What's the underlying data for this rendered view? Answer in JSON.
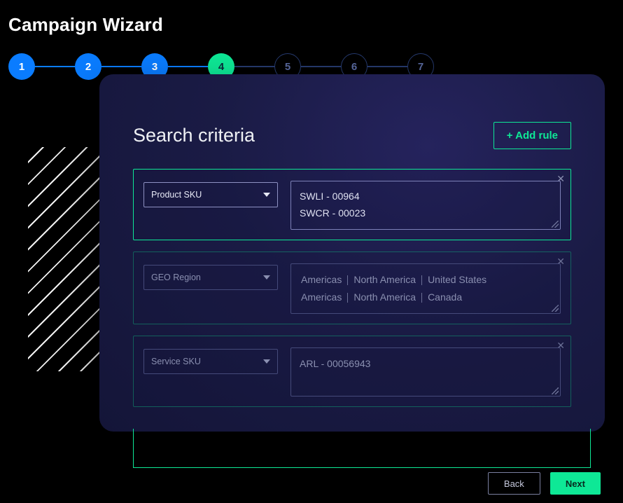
{
  "title": "Campaign Wizard",
  "stepper": {
    "steps": [
      "1",
      "2",
      "3",
      "4",
      "5",
      "6",
      "7"
    ],
    "current_index": 3
  },
  "section": {
    "title": "Search criteria",
    "add_rule_label": "+ Add rule"
  },
  "rules": [
    {
      "field": "Product SKU",
      "active": true,
      "lines": [
        "SWLI - 00964",
        "SWCR - 00023"
      ]
    },
    {
      "field": "GEO Region",
      "active": false,
      "geo_rows": [
        [
          "Americas",
          "North America",
          "United States"
        ],
        [
          "Americas",
          "North America",
          "Canada"
        ]
      ]
    },
    {
      "field": "Service SKU",
      "active": false,
      "lines": [
        "ARL - 00056943"
      ]
    }
  ],
  "actions": {
    "back": "Back",
    "next": "Next"
  }
}
